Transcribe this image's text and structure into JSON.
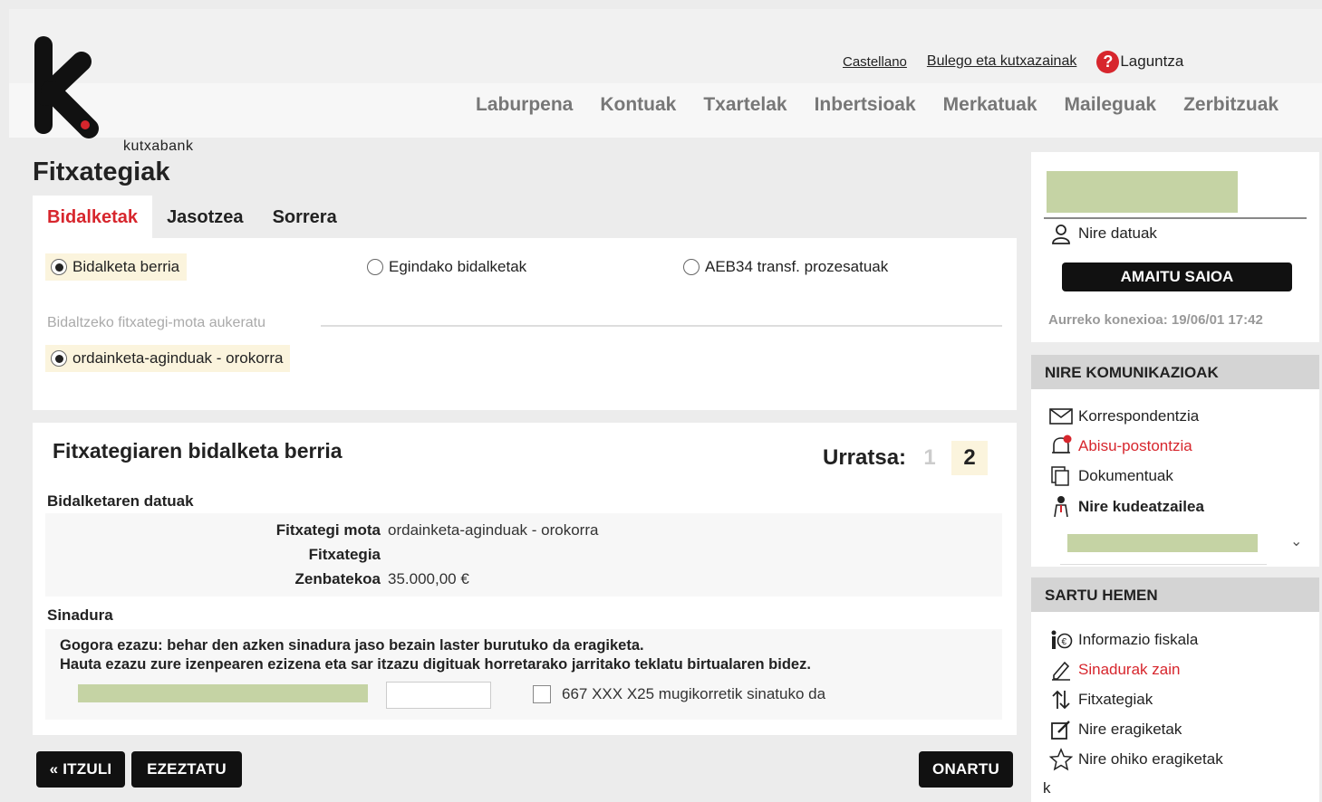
{
  "header": {
    "logo_text": "kutxabank",
    "links": {
      "language": "Castellano",
      "offices": "Bulego eta kutxazainak",
      "help": "Laguntza",
      "help_icon": "?"
    },
    "nav": [
      "Laburpena",
      "Kontuak",
      "Txartelak",
      "Inbertsioak",
      "Merkatuak",
      "Maileguak",
      "Zerbitzuak"
    ]
  },
  "page": {
    "title": "Fitxategiak",
    "tabs": [
      "Bidalketak",
      "Jasotzea",
      "Sorrera"
    ],
    "active_tab": "Bidalketak",
    "options": {
      "new": "Bidalketa berria",
      "done": "Egindako bidalketak",
      "aeb34": "AEB34 transf. prozesatuak"
    },
    "select_legend": "Bidaltzeko fitxategi-mota aukeratu",
    "file_type_option": "ordainketa-aginduak - orokorra"
  },
  "wizard": {
    "title": "Fitxategiaren bidalketa berria",
    "step_label": "Urratsa:",
    "step1": "1",
    "step2": "2",
    "data_heading": "Bidalketaren datuak",
    "rows": [
      {
        "label": "Fitxategi mota",
        "value": "ordainketa-aginduak - orokorra"
      },
      {
        "label": "Fitxategia",
        "value": ""
      },
      {
        "label": "Zenbatekoa",
        "value": "35.000,00 €"
      }
    ],
    "signature_heading": "Sinadura",
    "sign_line1": "Gogora ezazu: behar den azken sinadura jaso bezain laster burutuko da eragiketa.",
    "sign_line2": "Hauta ezazu zure izenpearen ezizena eta sar itzazu digituak horretarako jarritako teklatu birtualaren bidez.",
    "mobile_sign": "667 XXX X25 mugikorretik sinatuko da"
  },
  "buttons": {
    "back": "« ITZULI",
    "cancel": "EZEZTATU",
    "accept": "ONARTU"
  },
  "sidebar": {
    "my_data": "Nire datuak",
    "logout": "AMAITU SAIOA",
    "last_login": "Aurreko konexioa: 19/06/01 17:42",
    "comm_heading": "NIRE KOMUNIKAZIOAK",
    "comm_items": [
      "Korrespondentzia",
      "Abisu-postontzia",
      "Dokumentuak",
      "Nire kudeatzailea"
    ],
    "enter_heading": "SARTU HEMEN",
    "enter_items": [
      "Informazio fiskala",
      "Sinadurak zain",
      "Fitxategiak",
      "Nire eragiketak",
      "Nire ohiko eragiketak"
    ],
    "trailing": "k"
  },
  "colors": {
    "accent_red": "#d7262d",
    "redacted_green": "#c5d3a4",
    "highlight": "#fbf4dd"
  }
}
